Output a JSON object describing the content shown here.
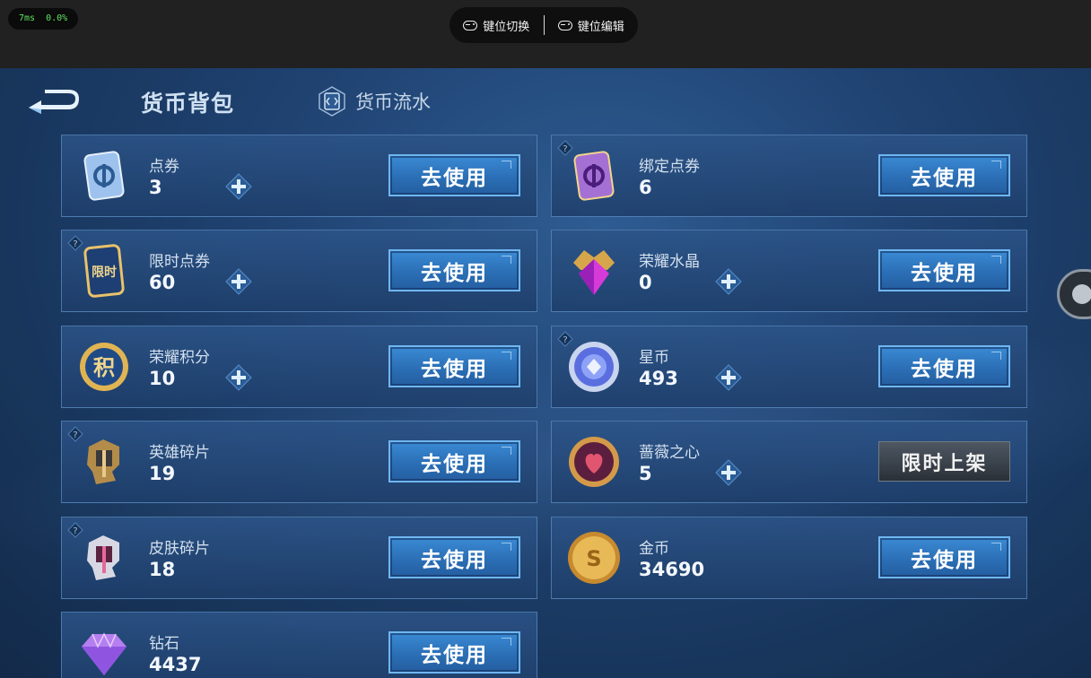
{
  "perf": {
    "latency": "7ms",
    "loss": "0.0%"
  },
  "keymap": {
    "switch_label": "键位切换",
    "edit_label": "键位编辑"
  },
  "header": {
    "tab_wallet": "货币背包",
    "tab_flow": "货币流水"
  },
  "action_label": "去使用",
  "limited_label": "限时上架",
  "currencies": [
    {
      "name": "点券",
      "amount": "3",
      "icon": "voucher-card-icon"
    },
    {
      "name": "绑定点券",
      "amount": "6",
      "icon": "bound-voucher-card-icon"
    },
    {
      "name": "限时点券",
      "amount": "60",
      "icon": "limited-voucher-icon",
      "icon_text": "限时"
    },
    {
      "name": "荣耀水晶",
      "amount": "0",
      "icon": "glory-crystal-icon"
    },
    {
      "name": "荣耀积分",
      "amount": "10",
      "icon": "glory-points-icon",
      "icon_text": "积"
    },
    {
      "name": "星币",
      "amount": "493",
      "icon": "star-coin-icon"
    },
    {
      "name": "英雄碎片",
      "amount": "19",
      "icon": "hero-fragment-icon"
    },
    {
      "name": "蔷薇之心",
      "amount": "5",
      "icon": "rose-heart-icon"
    },
    {
      "name": "皮肤碎片",
      "amount": "18",
      "icon": "skin-fragment-icon"
    },
    {
      "name": "金币",
      "amount": "34690",
      "icon": "gold-coin-icon",
      "icon_text": "S"
    },
    {
      "name": "钻石",
      "amount": "4437",
      "icon": "diamond-icon"
    }
  ],
  "colors": {
    "button": "#2b6fb6",
    "button_border": "#6fb6f1",
    "card_border": "#6ea0d7",
    "bg": "#1f4271"
  }
}
